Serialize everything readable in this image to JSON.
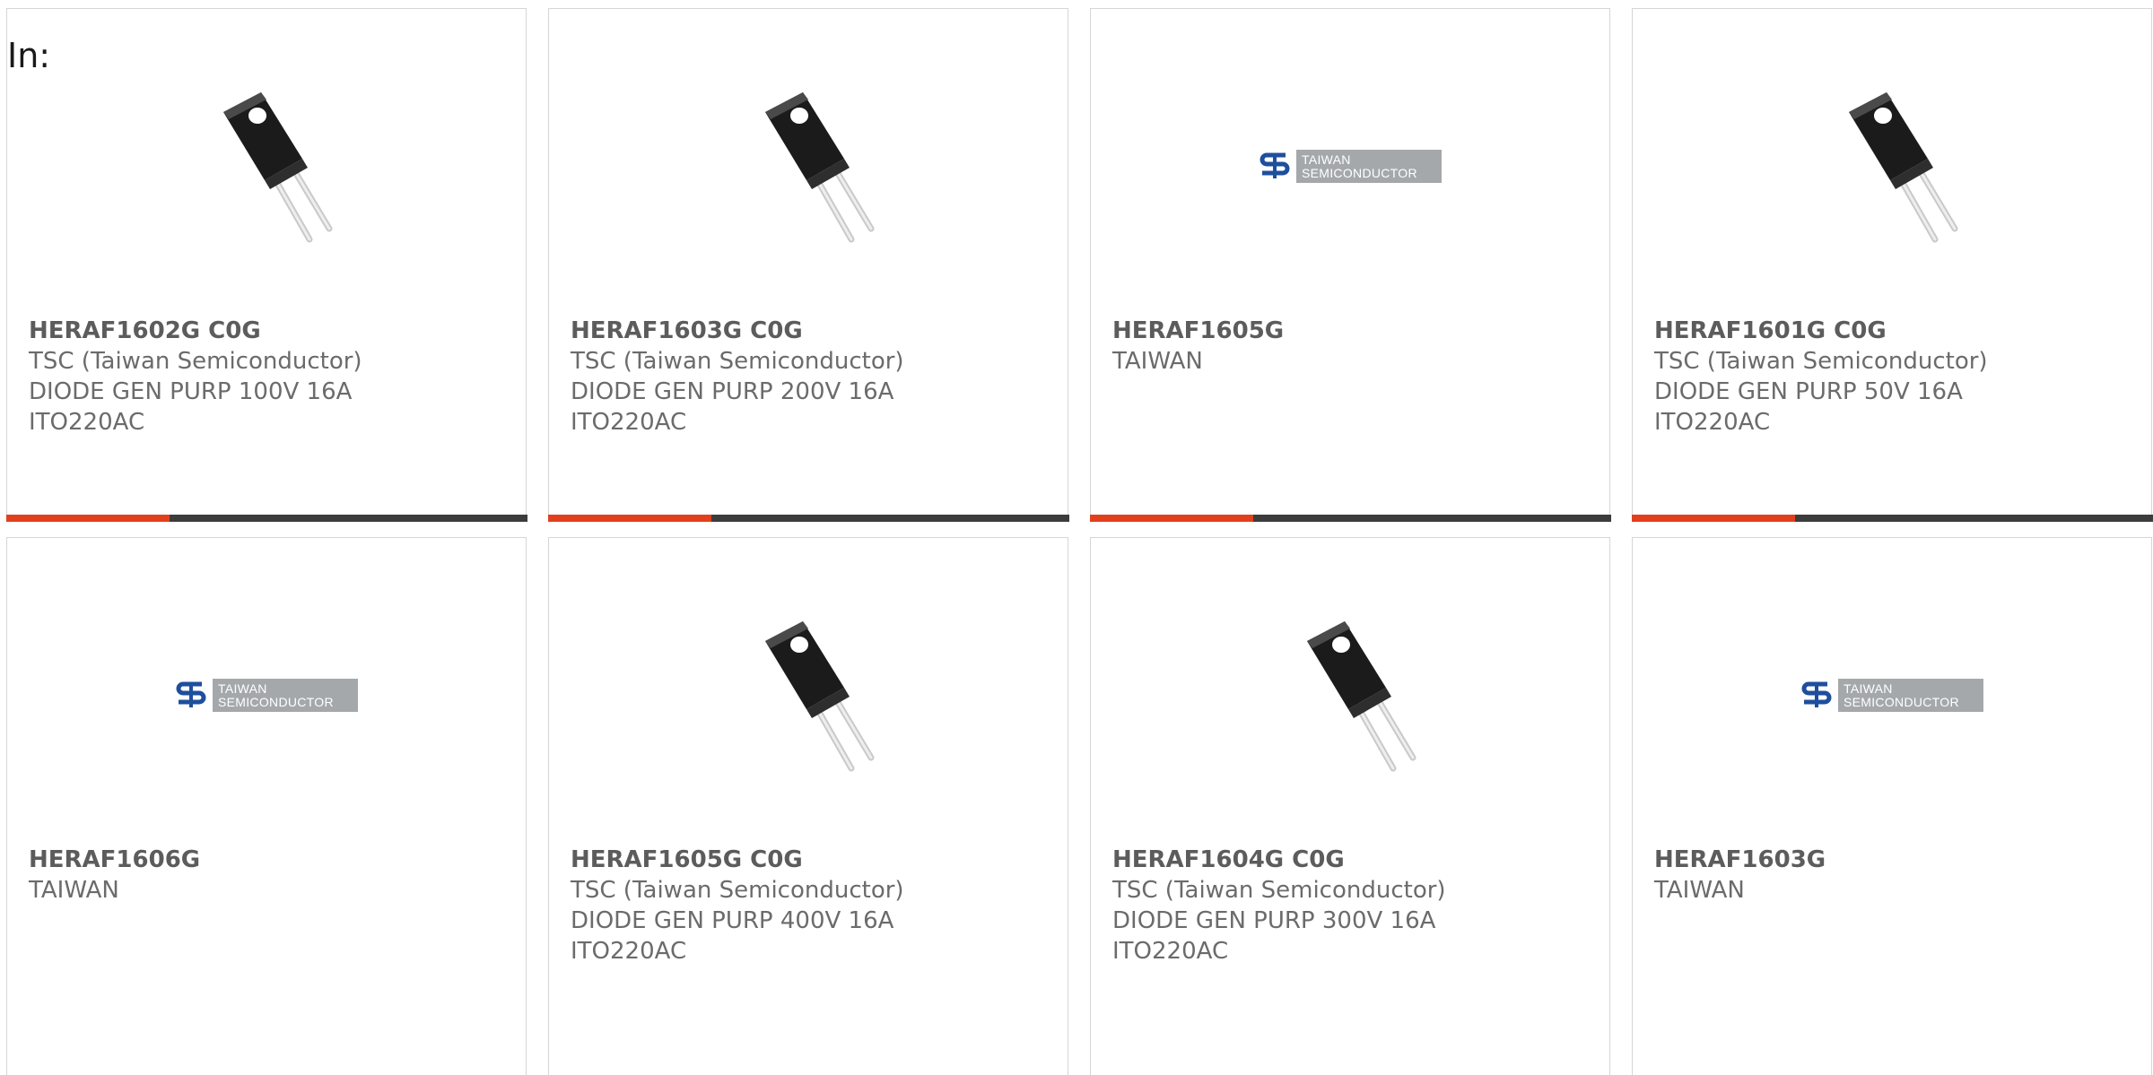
{
  "header": {
    "label": "In:"
  },
  "colors": {
    "accent": "#e2401c",
    "bar": "#3c3c3c",
    "border": "#d6d6d6",
    "text": "#6b6b6b"
  },
  "logo_text": {
    "line1": "TAIWAN",
    "line2": "SEMICONDUCTOR"
  },
  "products": [
    {
      "part": "HERAF1602G C0G",
      "lines": [
        "TSC (Taiwan Semiconductor)",
        "DIODE GEN PURP 100V 16A",
        "ITO220AC"
      ],
      "image": "diode-package"
    },
    {
      "part": "HERAF1603G C0G",
      "lines": [
        "TSC (Taiwan Semiconductor)",
        "DIODE GEN PURP 200V 16A",
        "ITO220AC"
      ],
      "image": "diode-package"
    },
    {
      "part": "HERAF1605G",
      "lines": [
        "TAIWAN"
      ],
      "image": "taiwan-semiconductor-logo"
    },
    {
      "part": "HERAF1601G C0G",
      "lines": [
        "TSC (Taiwan Semiconductor)",
        "DIODE GEN PURP 50V 16A",
        "ITO220AC"
      ],
      "image": "diode-package"
    },
    {
      "part": "HERAF1606G",
      "lines": [
        "TAIWAN"
      ],
      "image": "taiwan-semiconductor-logo"
    },
    {
      "part": "HERAF1605G C0G",
      "lines": [
        "TSC (Taiwan Semiconductor)",
        "DIODE GEN PURP 400V 16A",
        "ITO220AC"
      ],
      "image": "diode-package"
    },
    {
      "part": "HERAF1604G C0G",
      "lines": [
        "TSC (Taiwan Semiconductor)",
        "DIODE GEN PURP 300V 16A",
        "ITO220AC"
      ],
      "image": "diode-package"
    },
    {
      "part": "HERAF1603G",
      "lines": [
        "TAIWAN"
      ],
      "image": "taiwan-semiconductor-logo"
    }
  ]
}
